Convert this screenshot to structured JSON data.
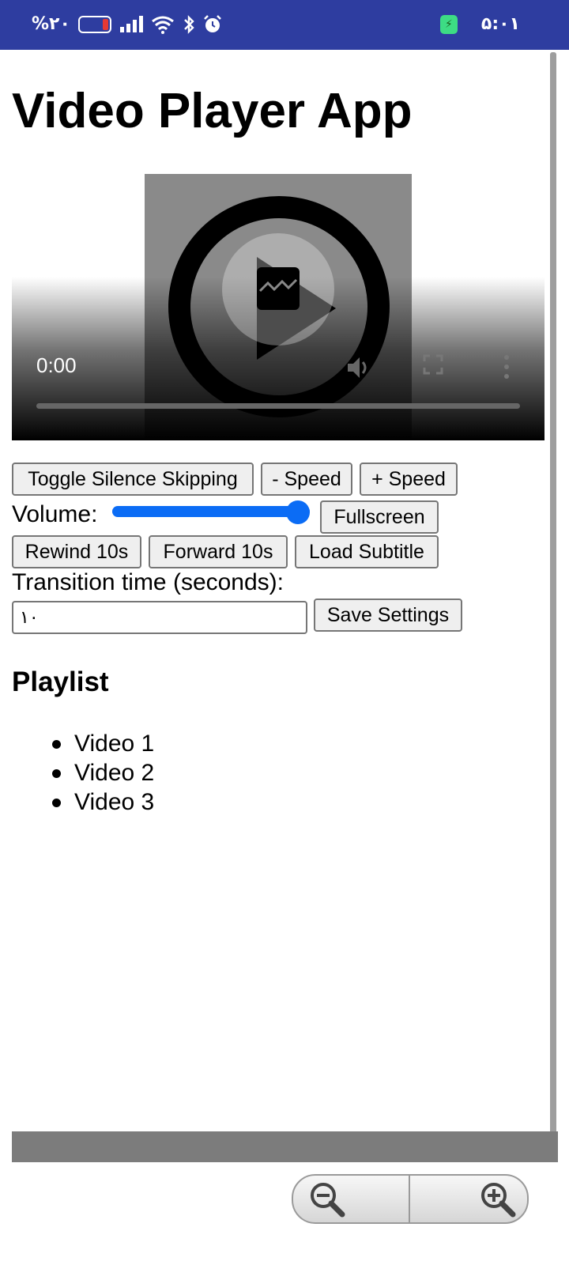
{
  "status_bar": {
    "battery_percent": "%۲۰",
    "time": "۵:۰۱",
    "icons": [
      "battery-icon",
      "signal-icon",
      "wifi-icon",
      "bluetooth-icon",
      "alarm-icon",
      "charging-icon"
    ]
  },
  "page": {
    "title": "Video Player App"
  },
  "video": {
    "current_time": "0:00",
    "icons": [
      "play-icon",
      "broken-image-icon",
      "volume-icon",
      "fullscreen-icon",
      "more-options-icon"
    ]
  },
  "controls": {
    "toggle_silence": "Toggle Silence Skipping",
    "speed_down": "- Speed",
    "speed_up": "+ Speed",
    "volume_label": "Volume:",
    "volume_value": 1.0,
    "fullscreen": "Fullscreen",
    "rewind": "Rewind 10s",
    "forward": "Forward 10s",
    "load_subtitle": "Load Subtitle",
    "transition_label": "Transition time (seconds):",
    "transition_value": "۱۰",
    "save_settings": "Save Settings"
  },
  "playlist": {
    "heading": "Playlist",
    "items": [
      "Video 1",
      "Video 2",
      "Video 3"
    ]
  },
  "zoom": {
    "icons": [
      "zoom-out-icon",
      "zoom-in-icon"
    ]
  },
  "colors": {
    "status_bar": "#2e3da0",
    "slider_accent": "#0b6cf5"
  }
}
